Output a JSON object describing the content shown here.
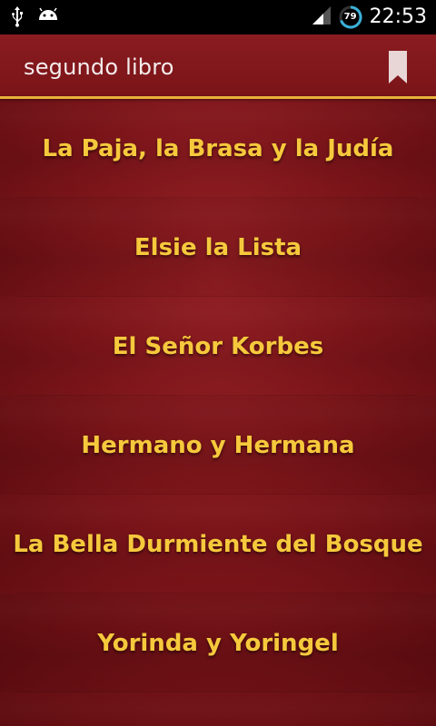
{
  "status_bar": {
    "icons": [
      "usb-icon",
      "android-icon",
      "signal-icon",
      "battery-icon"
    ],
    "battery_level": "79",
    "time": "22:53"
  },
  "action_bar": {
    "title": "segundo libro",
    "bookmark_icon": "bookmark-icon"
  },
  "stories": [
    {
      "label": "La Paja, la Brasa y la Judía"
    },
    {
      "label": "Elsie la Lista"
    },
    {
      "label": "El Señor Korbes"
    },
    {
      "label": "Hermano y Hermana"
    },
    {
      "label": "La Bella Durmiente del Bosque"
    },
    {
      "label": "Yorinda y Yoringel"
    }
  ],
  "colors": {
    "background": "#7a1419",
    "accent": "#e9b13a",
    "label": "#f6c93c",
    "title": "#f4ecec"
  }
}
